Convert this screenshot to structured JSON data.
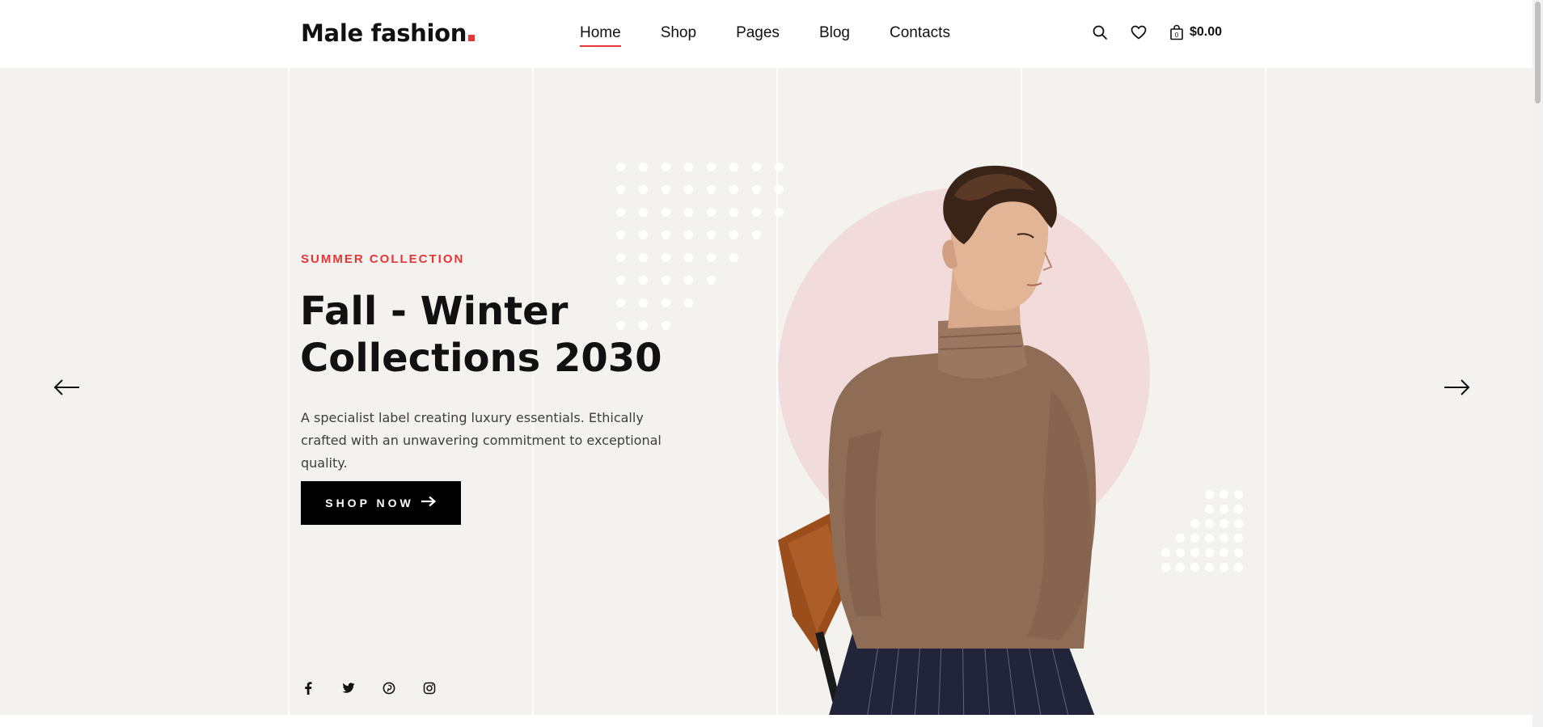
{
  "header": {
    "logo_text": "Male fashion",
    "nav": [
      {
        "label": "Home",
        "active": true
      },
      {
        "label": "Shop",
        "active": false
      },
      {
        "label": "Pages",
        "active": false
      },
      {
        "label": "Blog",
        "active": false
      },
      {
        "label": "Contacts",
        "active": false
      }
    ],
    "cart_total": "$0.00",
    "cart_count": "0",
    "icons": [
      "search-icon",
      "heart-icon",
      "bag-icon"
    ]
  },
  "hero": {
    "tag": "SUMMER COLLECTION",
    "title": "Fall - Winter Collections 2030",
    "description": "A specialist label creating luxury essentials. Ethically crafted with an unwavering commitment to exceptional quality.",
    "cta_label": "SHOP NOW",
    "arrows": [
      "arrow-left-icon",
      "arrow-right-icon"
    ],
    "social": [
      "facebook-icon",
      "twitter-icon",
      "pinterest-icon",
      "instagram-icon"
    ]
  },
  "colors": {
    "accent": "#e53637",
    "hero_bg": "#f3f2ee",
    "circle": "#f2dcdb",
    "button_bg": "#000000",
    "text": "#111111"
  }
}
